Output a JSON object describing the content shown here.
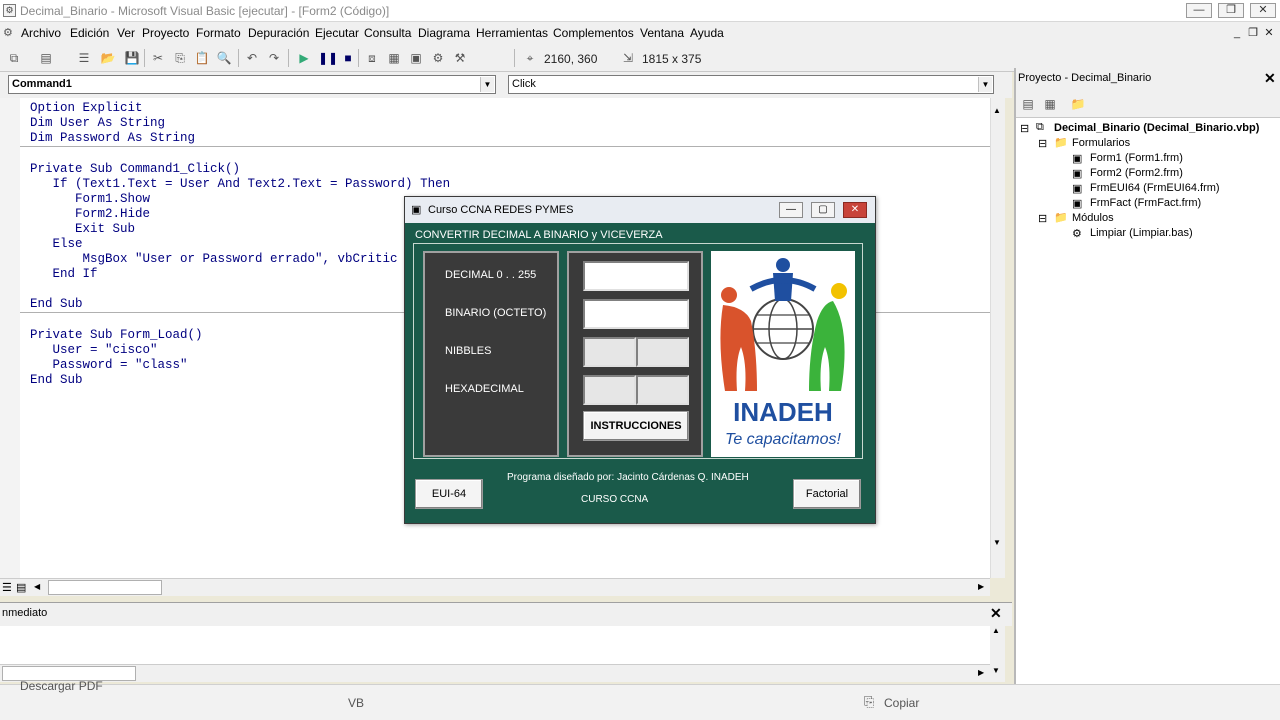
{
  "window": {
    "title": "Decimal_Binario - Microsoft Visual Basic [ejecutar] - [Form2 (Código)]",
    "minimize": "—",
    "restore": "❐",
    "close": "✕"
  },
  "menu": [
    "Archivo",
    "Edición",
    "Ver",
    "Proyecto",
    "Formato",
    "Depuración",
    "Ejecutar",
    "Consulta",
    "Diagrama",
    "Herramientas",
    "Complementos",
    "Ventana",
    "Ayuda"
  ],
  "toolbar": {
    "position": "2160, 360",
    "size": "1815 x 375"
  },
  "code": {
    "object_combo": "Command1",
    "procedure_combo": "Click",
    "lines": [
      "Option Explicit",
      "Dim User As String",
      "Dim Password As String",
      "Private Sub Command1_Click()",
      "   If (Text1.Text = User And Text2.Text = Password) Then",
      "      Form1.Show",
      "      Form2.Hide",
      "      Exit Sub",
      "   Else",
      "       MsgBox \"User or Password errado\", vbCritic",
      "   End If",
      "End Sub",
      "Private Sub Form_Load()",
      "   User = \"cisco\"",
      "   Password = \"class\"",
      "End Sub"
    ]
  },
  "immediate": {
    "title": "nmediato",
    "close": "✕"
  },
  "project": {
    "title": "Proyecto - Decimal_Binario",
    "close": "✕",
    "root": "Decimal_Binario (Decimal_Binario.vbp)",
    "folder_forms": "Formularios",
    "forms": [
      "Form1 (Form1.frm)",
      "Form2 (Form2.frm)",
      "FrmEUI64 (FrmEUI64.frm)",
      "FrmFact (FrmFact.frm)"
    ],
    "folder_modules": "Módulos",
    "modules": [
      "Limpiar (Limpiar.bas)"
    ]
  },
  "dialog": {
    "title": "Curso CCNA REDES PYMES",
    "heading": "CONVERTIR DECIMAL A BINARIO y VICEVERZA",
    "labels": [
      "DECIMAL  0 . . 255",
      "BINARIO (OCTETO)",
      "NIBBLES",
      "HEXADECIMAL"
    ],
    "instructions_button": "INSTRUCCIONES",
    "logo_name": "INADEH",
    "logo_slogan": "Te capacitamos!",
    "credit": "Programa diseñado por: Jacinto Cárdenas Q.    INADEH",
    "course": "CURSO CCNA",
    "eui_button": "EUI-64",
    "factorial_button": "Factorial"
  },
  "bottom": {
    "left_text": "Descargar PDF",
    "center_text": "VB",
    "copy_button": "Copiar"
  },
  "colors": {
    "dialog_bg": "#1a5a4a",
    "code_text": "#000080",
    "logo_blue": "#1f4fa0"
  }
}
